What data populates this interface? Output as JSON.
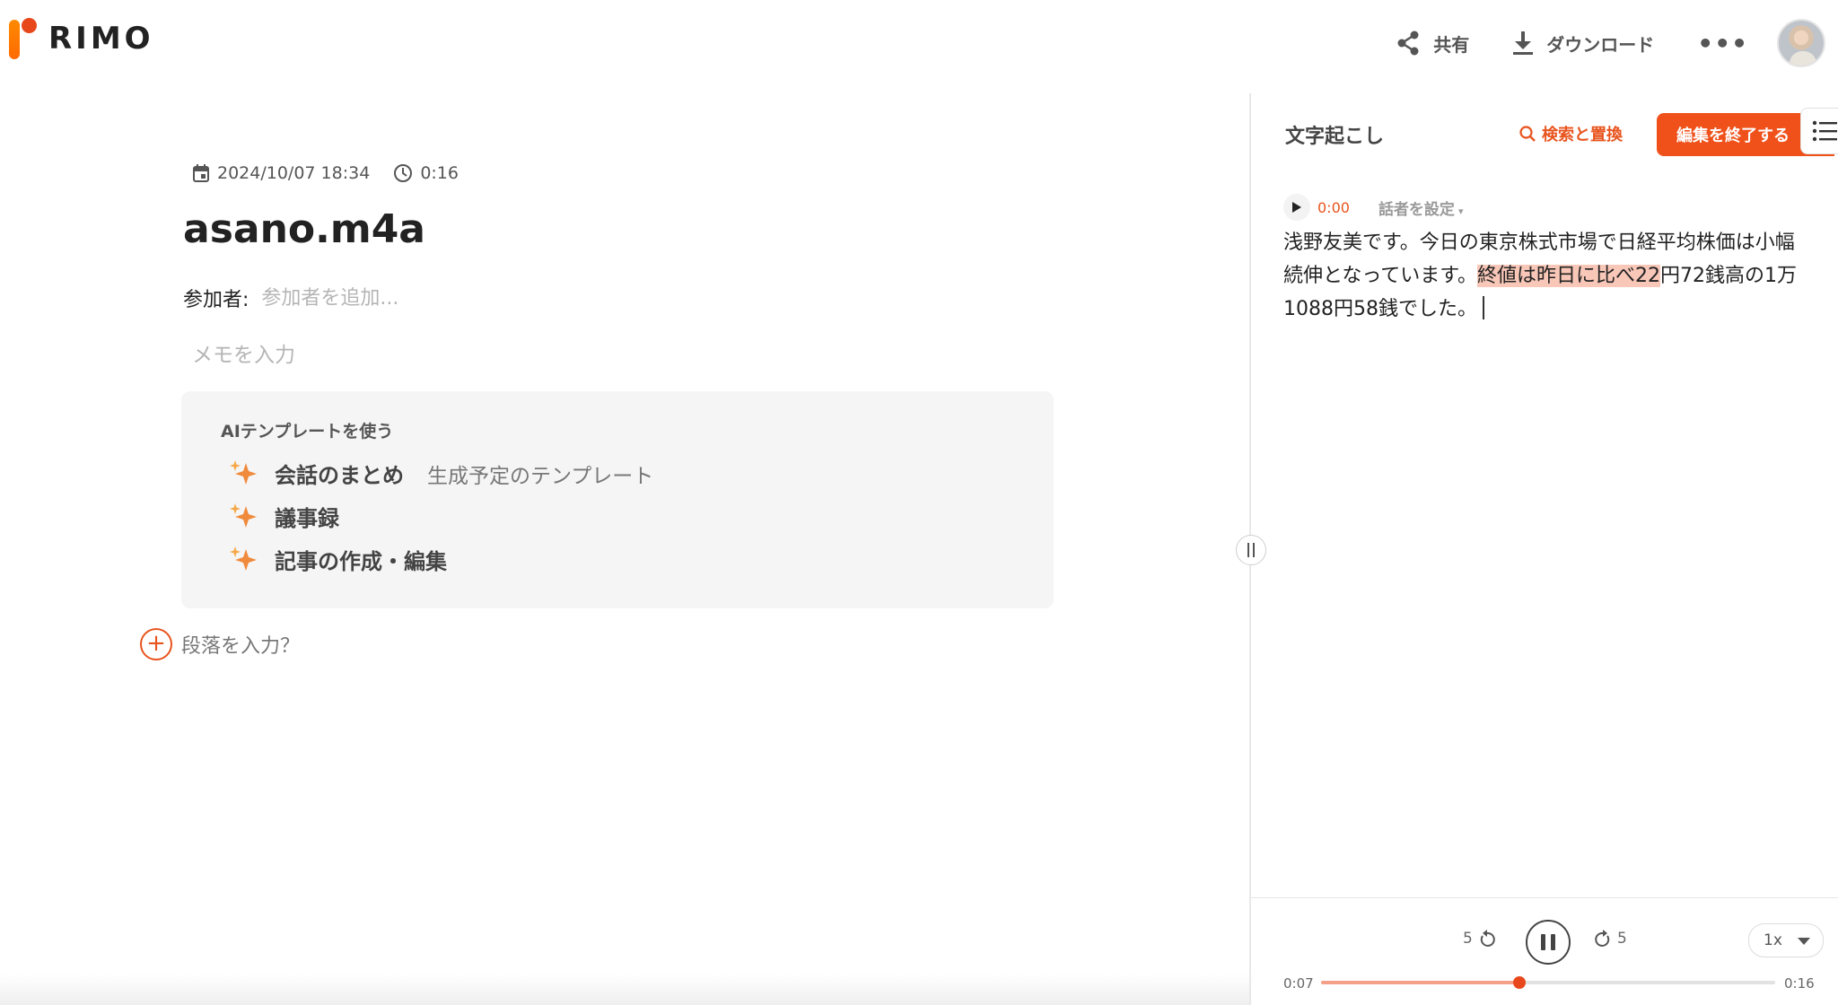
{
  "brand": {
    "name": "RIMO",
    "mark_bar_color": "#ff7a00",
    "mark_dot_color": "#e8471c"
  },
  "header": {
    "share_label": "共有",
    "download_label": "ダウンロード",
    "more_label": "•••"
  },
  "file": {
    "date": "2024/10/07 18:34",
    "duration": "0:16",
    "title": "asano.m4a"
  },
  "participants": {
    "label": "参加者:",
    "placeholder": "参加者を追加..."
  },
  "memo": {
    "placeholder": "メモを入力"
  },
  "ai_templates": {
    "heading": "AIテンプレートを使う",
    "items": [
      {
        "name": "会話のまとめ",
        "desc": "生成予定のテンプレート",
        "icon": "sparkle-icon"
      },
      {
        "name": "議事録",
        "desc": "",
        "icon": "sparkle-icon"
      },
      {
        "name": "記事の作成・編集",
        "desc": "",
        "icon": "sparkle-icon"
      }
    ]
  },
  "add_paragraph": {
    "plus": "+",
    "label": "段落を入力？"
  },
  "transcript": {
    "title": "文字起こし",
    "search_label": "検索と置換",
    "finish_label": "編集を終了する",
    "segment": {
      "time": "0:00",
      "speaker_label": "話者を設定",
      "speaker_caret": "▾",
      "text_before": "浅野友美です。今日の東京株式市場で日経平均株価は小幅続伸となっています。",
      "text_highlight": "終値は昨日に比べ22",
      "text_after": "円72銭高の1万1088円58銭でした。"
    }
  },
  "player": {
    "rewind_seconds": "5",
    "forward_seconds": "5",
    "speed": "1x",
    "current_time": "0:07",
    "total_time": "0:16",
    "progress_fraction": 0.4375,
    "accent_color": "#e8541e"
  }
}
